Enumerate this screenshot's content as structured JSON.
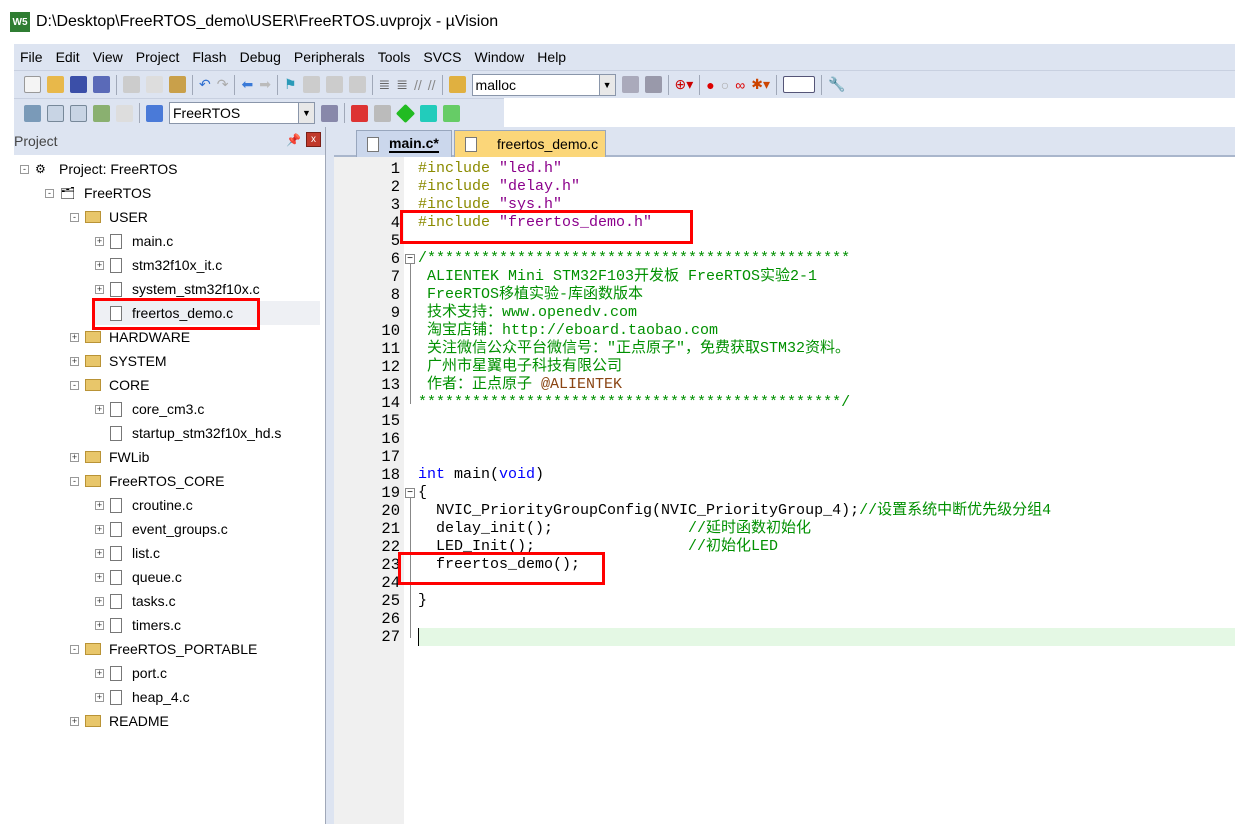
{
  "window": {
    "title": "D:\\Desktop\\FreeRTOS_demo\\USER\\FreeRTOS.uvprojx - µVision",
    "logo": "W5"
  },
  "menu": [
    "File",
    "Edit",
    "View",
    "Project",
    "Flash",
    "Debug",
    "Peripherals",
    "Tools",
    "SVCS",
    "Window",
    "Help"
  ],
  "toolbar": {
    "find_value": "malloc",
    "target_value": "FreeRTOS"
  },
  "project_panel": {
    "title": "Project",
    "pin_icon": "pin-icon",
    "close_icon": "close-icon",
    "tree": [
      {
        "label": "Project: FreeRTOS",
        "level": 0,
        "type": "project",
        "exp": "-"
      },
      {
        "label": "FreeRTOS",
        "level": 1,
        "type": "target",
        "exp": "-"
      },
      {
        "label": "USER",
        "level": 2,
        "type": "folder",
        "exp": "-"
      },
      {
        "label": "main.c",
        "level": 3,
        "type": "file",
        "exp": "+"
      },
      {
        "label": "stm32f10x_it.c",
        "level": 3,
        "type": "file",
        "exp": "+"
      },
      {
        "label": "system_stm32f10x.c",
        "level": 3,
        "type": "file",
        "exp": "+"
      },
      {
        "label": "freertos_demo.c",
        "level": 3,
        "type": "file",
        "exp": "",
        "selected": true
      },
      {
        "label": "HARDWARE",
        "level": 2,
        "type": "folder",
        "exp": "+"
      },
      {
        "label": "SYSTEM",
        "level": 2,
        "type": "folder",
        "exp": "+"
      },
      {
        "label": "CORE",
        "level": 2,
        "type": "folder",
        "exp": "-"
      },
      {
        "label": "core_cm3.c",
        "level": 3,
        "type": "file",
        "exp": "+"
      },
      {
        "label": "startup_stm32f10x_hd.s",
        "level": 3,
        "type": "file",
        "exp": ""
      },
      {
        "label": "FWLib",
        "level": 2,
        "type": "folder",
        "exp": "+"
      },
      {
        "label": "FreeRTOS_CORE",
        "level": 2,
        "type": "folder",
        "exp": "-"
      },
      {
        "label": "croutine.c",
        "level": 3,
        "type": "file",
        "exp": "+"
      },
      {
        "label": "event_groups.c",
        "level": 3,
        "type": "file",
        "exp": "+"
      },
      {
        "label": "list.c",
        "level": 3,
        "type": "file",
        "exp": "+"
      },
      {
        "label": "queue.c",
        "level": 3,
        "type": "file",
        "exp": "+"
      },
      {
        "label": "tasks.c",
        "level": 3,
        "type": "file",
        "exp": "+"
      },
      {
        "label": "timers.c",
        "level": 3,
        "type": "file",
        "exp": "+"
      },
      {
        "label": "FreeRTOS_PORTABLE",
        "level": 2,
        "type": "folder",
        "exp": "-"
      },
      {
        "label": "port.c",
        "level": 3,
        "type": "file",
        "exp": "+"
      },
      {
        "label": "heap_4.c",
        "level": 3,
        "type": "file",
        "exp": "+"
      },
      {
        "label": "README",
        "level": 2,
        "type": "folder",
        "exp": "+"
      }
    ]
  },
  "tabs": [
    {
      "label": "main.c*",
      "active": true
    },
    {
      "label": "freertos_demo.c",
      "active": false
    }
  ],
  "code": [
    [
      [
        "pp",
        "#include "
      ],
      [
        "str",
        "\"led.h\""
      ]
    ],
    [
      [
        "pp",
        "#include "
      ],
      [
        "str",
        "\"delay.h\""
      ]
    ],
    [
      [
        "pp",
        "#include "
      ],
      [
        "str",
        "\"sys.h\""
      ]
    ],
    [
      [
        "pp",
        "#include "
      ],
      [
        "str",
        "\"freertos_demo.h\""
      ]
    ],
    [],
    [
      [
        "cm",
        "/***********************************************"
      ]
    ],
    [
      [
        "cm",
        " ALIENTEK Mini STM32F103开发板 FreeRTOS实验2-1"
      ]
    ],
    [
      [
        "cm",
        " FreeRTOS移植实验-库函数版本"
      ]
    ],
    [
      [
        "cm",
        " 技术支持：www.openedv.com"
      ]
    ],
    [
      [
        "cm",
        " 淘宝店铺：http://eboard.taobao.com"
      ]
    ],
    [
      [
        "cm",
        " 关注微信公众平台微信号：\"正点原子\"，免费获取STM32资料。"
      ]
    ],
    [
      [
        "cm",
        " 广州市星翼电子科技有限公司"
      ]
    ],
    [
      [
        "cm",
        " 作者：正点原子 "
      ],
      [
        "at",
        "@ALIENTEK"
      ]
    ],
    [
      [
        "cm",
        "***********************************************/"
      ]
    ],
    [],
    [],
    [],
    [
      [
        "kw",
        "int"
      ],
      [
        "",
        " main("
      ],
      [
        "kw",
        "void"
      ],
      [
        "",
        ")"
      ]
    ],
    [
      [
        "",
        "{"
      ]
    ],
    [
      [
        "",
        "  NVIC_PriorityGroupConfig(NVIC_PriorityGroup_4);"
      ],
      [
        "cm",
        "//设置系统中断优先级分组4"
      ]
    ],
    [
      [
        "",
        "  delay_init();               "
      ],
      [
        "cm",
        "//延时函数初始化"
      ]
    ],
    [
      [
        "",
        "  LED_Init();                 "
      ],
      [
        "cm",
        "//初始化LED"
      ]
    ],
    [
      [
        "",
        "  freertos_demo();"
      ]
    ],
    [],
    [
      [
        "",
        "}"
      ]
    ],
    [],
    []
  ]
}
